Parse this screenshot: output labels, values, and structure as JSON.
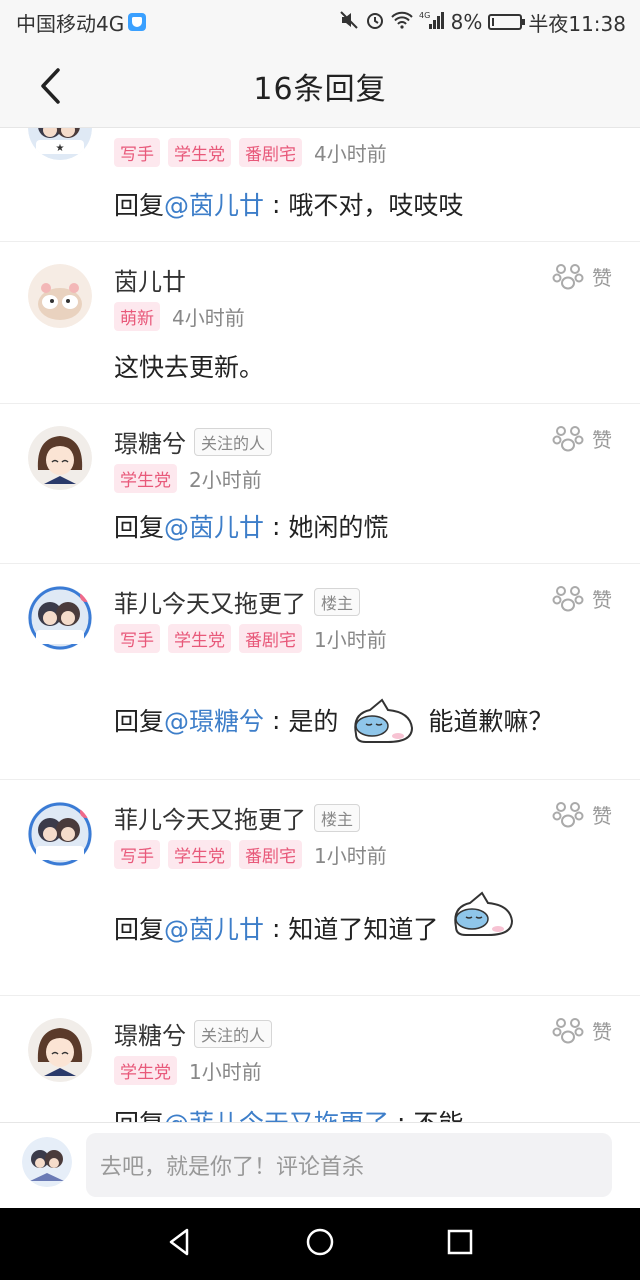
{
  "status_bar": {
    "carrier": "中国移动4G",
    "signal_label": "4G",
    "battery_percent": "8%",
    "battery_level": 0.08,
    "time": "半夜11:38"
  },
  "header": {
    "title": "16条回复",
    "back_icon": "chevron-left-icon"
  },
  "colors": {
    "mention": "#3d7ec9",
    "tag_text": "#e8597a",
    "tag_bg": "#fde8ee"
  },
  "replies": [
    {
      "name": "",
      "tags": [
        "写手",
        "学生党",
        "番剧宅"
      ],
      "time": "4小时前",
      "prefix": "回复 ",
      "mention": "@茵儿廿",
      "text": "哦不对，吱吱吱",
      "suffix": ""
    },
    {
      "name": "茵儿廿",
      "tags": [
        "萌新"
      ],
      "time": "4小时前",
      "like_label": "赞",
      "prefix": "",
      "mention": "",
      "text": "这快去更新。",
      "suffix": ""
    },
    {
      "name": "璟糖兮",
      "badge": "关注的人",
      "tags": [
        "学生党"
      ],
      "time": "2小时前",
      "like_label": "赞",
      "prefix": "回复 ",
      "mention": "@茵儿廿",
      "text": "她闲的慌",
      "suffix": ""
    },
    {
      "name": "菲儿今天又拖更了",
      "badge": "楼主",
      "tags": [
        "写手",
        "学生党",
        "番剧宅"
      ],
      "time": "1小时前",
      "like_label": "赞",
      "prefix": "回复 ",
      "mention": "@璟糖兮",
      "text": "是的",
      "suffix": "能道歉嘛？"
    },
    {
      "name": "菲儿今天又拖更了",
      "badge": "楼主",
      "tags": [
        "写手",
        "学生党",
        "番剧宅"
      ],
      "time": "1小时前",
      "like_label": "赞",
      "prefix": "回复 ",
      "mention": "@茵儿廿",
      "text": "知道了知道了",
      "suffix": ""
    },
    {
      "name": "璟糖兮",
      "badge": "关注的人",
      "tags": [
        "学生党"
      ],
      "time": "1小时前",
      "like_label": "赞",
      "prefix": "回复 ",
      "mention": "@菲儿今天又拖更了",
      "text": "不能",
      "suffix": ""
    }
  ],
  "comment_bar": {
    "placeholder": "去吧，就是你了！评论首杀"
  },
  "nav_bar": {
    "back": "back-triangle-icon",
    "home": "home-circle-icon",
    "recents": "recents-square-icon"
  }
}
